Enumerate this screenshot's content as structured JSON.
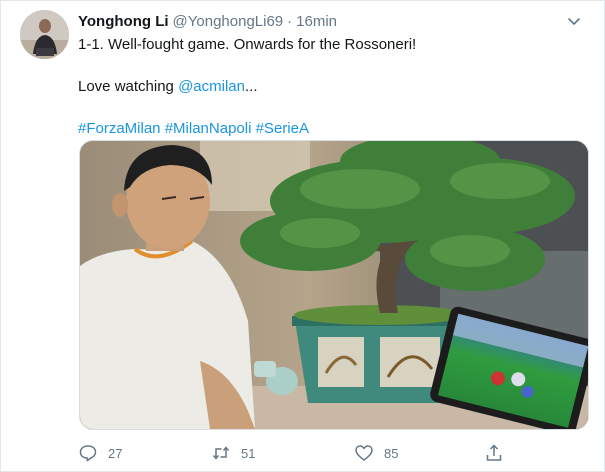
{
  "tweet": {
    "author_name": "Yonghong Li",
    "handle": "@YonghongLi69",
    "separator": "·",
    "time": "16min",
    "line1": "1-1. Well-fought game. Onwards for the Rossoneri!",
    "line2_prefix": "Love watching ",
    "mention": "@acmilan",
    "line2_suffix": "...",
    "hashtags": [
      "#ForzaMilan",
      "#MilanNapoli",
      "#SerieA"
    ],
    "reply_count": "27",
    "retweet_count": "51",
    "like_count": "85"
  },
  "icons": [
    "chevron-down-icon",
    "reply-icon",
    "retweet-icon",
    "heart-icon",
    "share-icon"
  ],
  "colors": {
    "link": "#1b95e0",
    "secondary_text": "#657786"
  }
}
